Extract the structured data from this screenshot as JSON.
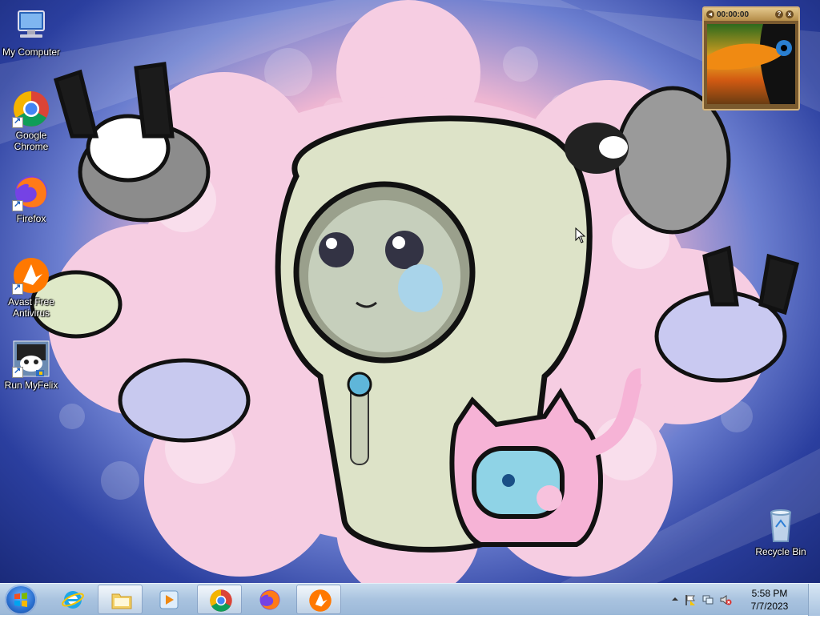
{
  "desktop": {
    "icons": [
      {
        "label": "My Computer",
        "icon": "computer-icon"
      },
      {
        "label": "Google Chrome",
        "icon": "chrome-icon"
      },
      {
        "label": "Firefox",
        "icon": "firefox-icon"
      },
      {
        "label": "Avast Free Antivirus",
        "icon": "avast-icon"
      },
      {
        "label": "Run MyFelix",
        "icon": "myfelix-icon"
      },
      {
        "label": "Recycle Bin",
        "icon": "recycle-bin-icon"
      }
    ]
  },
  "media_widget": {
    "timer": "00:00:00",
    "help_label": "?",
    "close_label": "x"
  },
  "taskbar": {
    "pinned": [
      {
        "name": "internet-explorer",
        "icon": "ie-icon"
      },
      {
        "name": "file-explorer",
        "icon": "folder-icon"
      },
      {
        "name": "media-player",
        "icon": "media-player-icon"
      },
      {
        "name": "chrome",
        "icon": "chrome-icon"
      },
      {
        "name": "firefox",
        "icon": "firefox-icon"
      },
      {
        "name": "avast",
        "icon": "avast-icon"
      }
    ],
    "clock": {
      "time": "5:58 PM",
      "date": "7/7/2023"
    }
  },
  "colors": {
    "taskbar_top": "#c9dcee",
    "taskbar_bottom": "#9bb8d8",
    "wallpaper_pink": "#f3c7de",
    "wallpaper_blue": "#2b3f9f"
  }
}
